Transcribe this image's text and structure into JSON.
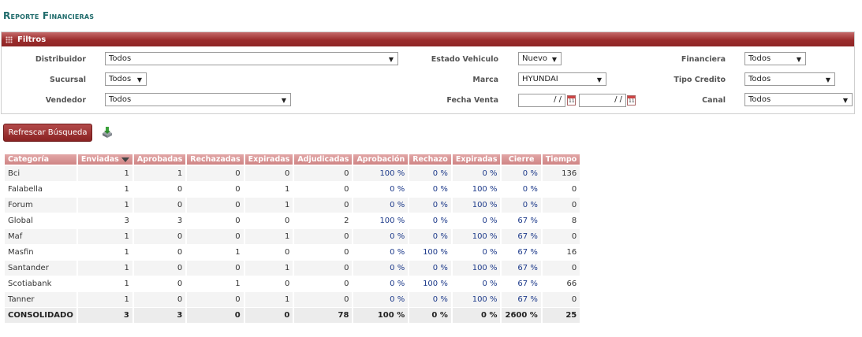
{
  "page_title": "Reporte Financieras",
  "filters": {
    "header": "Filtros",
    "distribuidor": {
      "label": "Distribuidor",
      "value": "Todos"
    },
    "sucursal": {
      "label": "Sucursal",
      "value": "Todos"
    },
    "vendedor": {
      "label": "Vendedor",
      "value": "Todos"
    },
    "estado_vehiculo": {
      "label": "Estado Vehiculo",
      "value": "Nuevo"
    },
    "marca": {
      "label": "Marca",
      "value": "HYUNDAI"
    },
    "fecha_venta": {
      "label": "Fecha Venta",
      "from": "/ /",
      "to": "/ /"
    },
    "financiera": {
      "label": "Financiera",
      "value": "Todos"
    },
    "tipo_credito": {
      "label": "Tipo Credito",
      "value": "Todos"
    },
    "canal": {
      "label": "Canal",
      "value": "Todos"
    }
  },
  "actions": {
    "refresh_label": "Refrescar Búsqueda"
  },
  "table": {
    "headers": [
      "Categoría",
      "Enviadas",
      "Aprobadas",
      "Rechazadas",
      "Expiradas",
      "Adjudicadas",
      "Aprobación",
      "Rechazo",
      "Expiradas",
      "Cierre",
      "Tiempo"
    ],
    "rows": [
      [
        "Bci",
        "1",
        "1",
        "0",
        "0",
        "0",
        "100 %",
        "0 %",
        "0 %",
        "0 %",
        "136"
      ],
      [
        "Falabella",
        "1",
        "0",
        "0",
        "1",
        "0",
        "0 %",
        "0 %",
        "100 %",
        "0 %",
        "0"
      ],
      [
        "Forum",
        "1",
        "0",
        "0",
        "1",
        "0",
        "0 %",
        "0 %",
        "100 %",
        "0 %",
        "0"
      ],
      [
        "Global",
        "3",
        "3",
        "0",
        "0",
        "2",
        "100 %",
        "0 %",
        "0 %",
        "67 %",
        "8"
      ],
      [
        "Maf",
        "1",
        "0",
        "0",
        "1",
        "0",
        "0 %",
        "0 %",
        "100 %",
        "67 %",
        "0"
      ],
      [
        "Masfin",
        "1",
        "0",
        "1",
        "0",
        "0",
        "0 %",
        "100 %",
        "0 %",
        "67 %",
        "16"
      ],
      [
        "Santander",
        "1",
        "0",
        "0",
        "1",
        "0",
        "0 %",
        "0 %",
        "100 %",
        "67 %",
        "0"
      ],
      [
        "Scotiabank",
        "1",
        "0",
        "1",
        "0",
        "0",
        "0 %",
        "100 %",
        "0 %",
        "67 %",
        "66"
      ],
      [
        "Tanner",
        "1",
        "0",
        "0",
        "1",
        "0",
        "0 %",
        "0 %",
        "100 %",
        "67 %",
        "0"
      ]
    ],
    "total": [
      "CONSOLIDADO",
      "3",
      "3",
      "0",
      "0",
      "78",
      "100 %",
      "0 %",
      "0 %",
      "2600 %",
      "25"
    ]
  }
}
